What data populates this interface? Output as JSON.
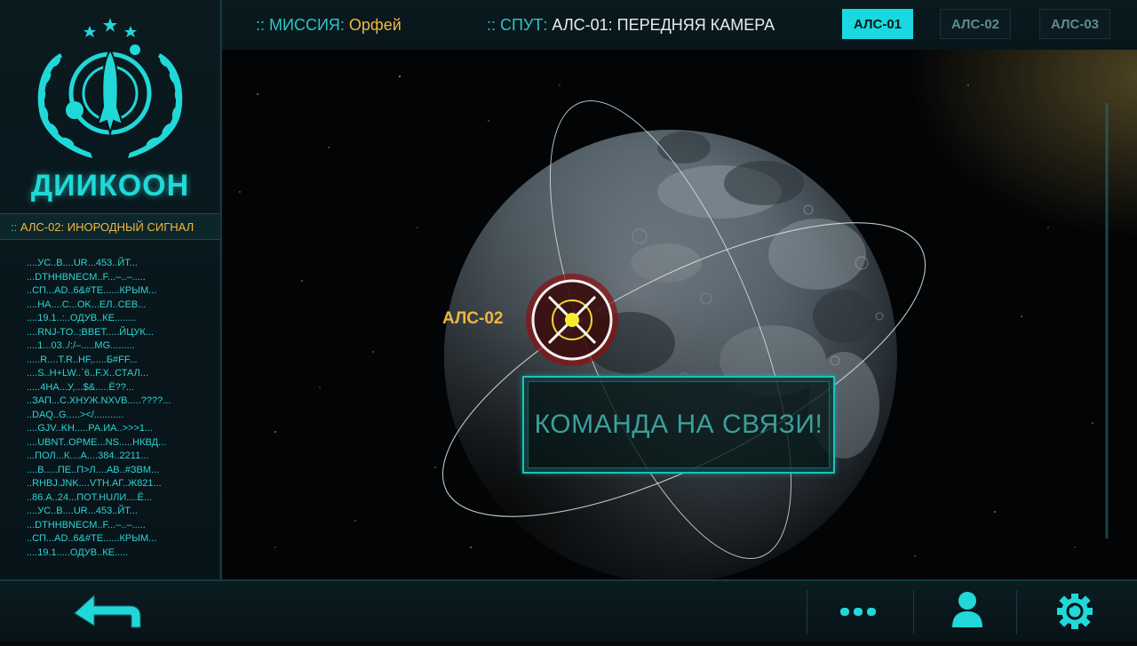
{
  "app": {
    "logo_text": "ДИИКООН"
  },
  "sidebar": {
    "section_prefix": "::",
    "section_title": "АЛС-02: ИНОРОДНЫЙ СИГНАЛ",
    "log_lines": [
      "....УС..В....UR...453..ЙТ...",
      "...DTHHBNECM..F...–..–.....",
      "..СП...AD..6&#TE......КРЫМ...",
      "....НА....С...OK...ЕЛ..СЕВ...",
      "....19.1..:..ОДУВ..КЕ........",
      "....RNJ-TO..;ВВЕТ.....ЙЦУК...",
      "....1...03../:/–.....MG.........",
      ".....R....T.R..HF,.....Б#FF...",
      "....S..Н+LW..`6..F.X..СТАЛ...",
      ".....4НА...У,...$&.....Ё??...",
      "..ЗАП...С.ХНУЖ.NXVB.....????...",
      "..DAQ..G.....></...........",
      "....GJV..KH.....РА.ИА..>>>1...",
      "....UBNT..OPME...NS.....НКВД...",
      "...ПОЛ...К....А....384..2211...",
      "....В.....ПЕ..П>Л....AB..#ЗВМ...",
      "..RHBJ.JNK....VTH.АГ..Ж821...",
      "..86.А..24...ПОТ.HUЛИ....Ё...",
      "....УС..В....UR...453..ЙТ...",
      "...DTHHBNECM..F...–..–.....",
      "..СП...AD..6&#TE......КРЫМ...",
      "....19.1.....ОДУВ..КЕ....."
    ]
  },
  "topbar": {
    "mission_prefix": "::",
    "mission_label": "МИССИЯ:",
    "mission_value": "Орфей",
    "sat_prefix": "::",
    "sat_label": "СПУТ:",
    "sat_value": "АЛС-01: ПЕРЕДНЯЯ КАМЕРА",
    "tabs": [
      {
        "label": "АЛС-01",
        "active": true
      },
      {
        "label": "АЛС-02",
        "active": false
      },
      {
        "label": "АЛС-03",
        "active": false
      }
    ]
  },
  "viewport": {
    "target_label": "АЛС-02",
    "dialog_text": "КОМАНДА НА СВЯЗИ!"
  },
  "bottombar": {
    "back": "back-arrow-icon",
    "more": "more-dots-icon",
    "profile": "user-icon",
    "settings": "gear-sync-icon"
  },
  "colors": {
    "accent": "#1ad8e0",
    "highlight": "#f0b640",
    "target_ring": "#a01818"
  }
}
